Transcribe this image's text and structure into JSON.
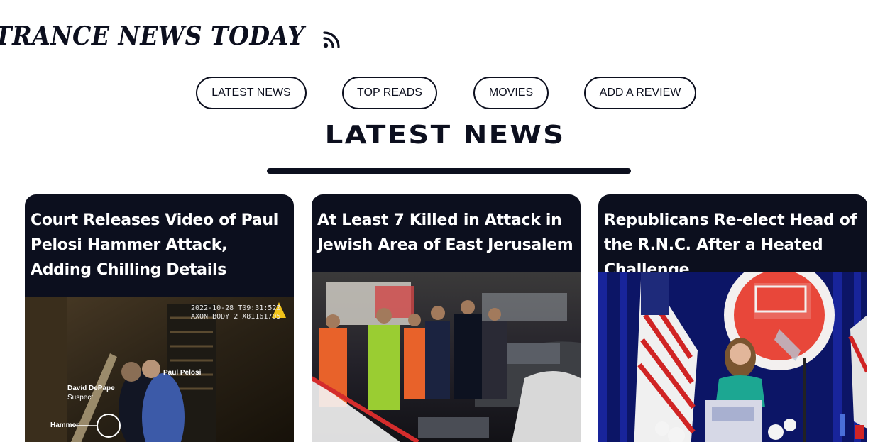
{
  "header": {
    "brand": "TRANCE NEWS TODAY",
    "brand_icon": "rss-icon"
  },
  "nav": {
    "items": [
      {
        "label": "LATEST NEWS"
      },
      {
        "label": "TOP READS"
      },
      {
        "label": "MOVIES"
      },
      {
        "label": "ADD A REVIEW"
      }
    ]
  },
  "section": {
    "title": "LATEST NEWS"
  },
  "colors": {
    "ink": "#0c0f1e",
    "card_bg": "#0c0f1e",
    "background": "#ffffff"
  },
  "articles": [
    {
      "title": "Court Releases Video of Paul Pelosi Hammer Attack, Adding Chilling Details",
      "image": {
        "timestamp": "2022-10-28 T09:31:52Z",
        "camera": "AXON BODY 2 X81161705",
        "label_right": "Paul Pelosi",
        "label_left_name": "David DePape",
        "label_left_role": "Suspect",
        "label_object": "Hammer"
      }
    },
    {
      "title": "At Least 7 Killed in Attack in Jewish Area of East Jerusalem"
    },
    {
      "title": "Republicans Re-elect Head of the R.N.C. After a Heated Challenge"
    }
  ]
}
